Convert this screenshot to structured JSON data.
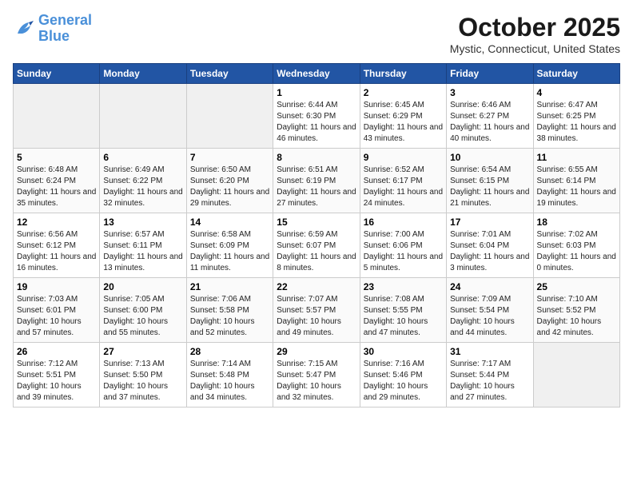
{
  "header": {
    "logo_line1": "General",
    "logo_line2": "Blue",
    "month": "October 2025",
    "location": "Mystic, Connecticut, United States"
  },
  "days_of_week": [
    "Sunday",
    "Monday",
    "Tuesday",
    "Wednesday",
    "Thursday",
    "Friday",
    "Saturday"
  ],
  "weeks": [
    [
      {
        "day": "",
        "empty": true
      },
      {
        "day": "",
        "empty": true
      },
      {
        "day": "",
        "empty": true
      },
      {
        "day": "1",
        "sunrise": "6:44 AM",
        "sunset": "6:30 PM",
        "daylight": "11 hours and 46 minutes."
      },
      {
        "day": "2",
        "sunrise": "6:45 AM",
        "sunset": "6:29 PM",
        "daylight": "11 hours and 43 minutes."
      },
      {
        "day": "3",
        "sunrise": "6:46 AM",
        "sunset": "6:27 PM",
        "daylight": "11 hours and 40 minutes."
      },
      {
        "day": "4",
        "sunrise": "6:47 AM",
        "sunset": "6:25 PM",
        "daylight": "11 hours and 38 minutes."
      }
    ],
    [
      {
        "day": "5",
        "sunrise": "6:48 AM",
        "sunset": "6:24 PM",
        "daylight": "11 hours and 35 minutes."
      },
      {
        "day": "6",
        "sunrise": "6:49 AM",
        "sunset": "6:22 PM",
        "daylight": "11 hours and 32 minutes."
      },
      {
        "day": "7",
        "sunrise": "6:50 AM",
        "sunset": "6:20 PM",
        "daylight": "11 hours and 29 minutes."
      },
      {
        "day": "8",
        "sunrise": "6:51 AM",
        "sunset": "6:19 PM",
        "daylight": "11 hours and 27 minutes."
      },
      {
        "day": "9",
        "sunrise": "6:52 AM",
        "sunset": "6:17 PM",
        "daylight": "11 hours and 24 minutes."
      },
      {
        "day": "10",
        "sunrise": "6:54 AM",
        "sunset": "6:15 PM",
        "daylight": "11 hours and 21 minutes."
      },
      {
        "day": "11",
        "sunrise": "6:55 AM",
        "sunset": "6:14 PM",
        "daylight": "11 hours and 19 minutes."
      }
    ],
    [
      {
        "day": "12",
        "sunrise": "6:56 AM",
        "sunset": "6:12 PM",
        "daylight": "11 hours and 16 minutes."
      },
      {
        "day": "13",
        "sunrise": "6:57 AM",
        "sunset": "6:11 PM",
        "daylight": "11 hours and 13 minutes."
      },
      {
        "day": "14",
        "sunrise": "6:58 AM",
        "sunset": "6:09 PM",
        "daylight": "11 hours and 11 minutes."
      },
      {
        "day": "15",
        "sunrise": "6:59 AM",
        "sunset": "6:07 PM",
        "daylight": "11 hours and 8 minutes."
      },
      {
        "day": "16",
        "sunrise": "7:00 AM",
        "sunset": "6:06 PM",
        "daylight": "11 hours and 5 minutes."
      },
      {
        "day": "17",
        "sunrise": "7:01 AM",
        "sunset": "6:04 PM",
        "daylight": "11 hours and 3 minutes."
      },
      {
        "day": "18",
        "sunrise": "7:02 AM",
        "sunset": "6:03 PM",
        "daylight": "11 hours and 0 minutes."
      }
    ],
    [
      {
        "day": "19",
        "sunrise": "7:03 AM",
        "sunset": "6:01 PM",
        "daylight": "10 hours and 57 minutes."
      },
      {
        "day": "20",
        "sunrise": "7:05 AM",
        "sunset": "6:00 PM",
        "daylight": "10 hours and 55 minutes."
      },
      {
        "day": "21",
        "sunrise": "7:06 AM",
        "sunset": "5:58 PM",
        "daylight": "10 hours and 52 minutes."
      },
      {
        "day": "22",
        "sunrise": "7:07 AM",
        "sunset": "5:57 PM",
        "daylight": "10 hours and 49 minutes."
      },
      {
        "day": "23",
        "sunrise": "7:08 AM",
        "sunset": "5:55 PM",
        "daylight": "10 hours and 47 minutes."
      },
      {
        "day": "24",
        "sunrise": "7:09 AM",
        "sunset": "5:54 PM",
        "daylight": "10 hours and 44 minutes."
      },
      {
        "day": "25",
        "sunrise": "7:10 AM",
        "sunset": "5:52 PM",
        "daylight": "10 hours and 42 minutes."
      }
    ],
    [
      {
        "day": "26",
        "sunrise": "7:12 AM",
        "sunset": "5:51 PM",
        "daylight": "10 hours and 39 minutes."
      },
      {
        "day": "27",
        "sunrise": "7:13 AM",
        "sunset": "5:50 PM",
        "daylight": "10 hours and 37 minutes."
      },
      {
        "day": "28",
        "sunrise": "7:14 AM",
        "sunset": "5:48 PM",
        "daylight": "10 hours and 34 minutes."
      },
      {
        "day": "29",
        "sunrise": "7:15 AM",
        "sunset": "5:47 PM",
        "daylight": "10 hours and 32 minutes."
      },
      {
        "day": "30",
        "sunrise": "7:16 AM",
        "sunset": "5:46 PM",
        "daylight": "10 hours and 29 minutes."
      },
      {
        "day": "31",
        "sunrise": "7:17 AM",
        "sunset": "5:44 PM",
        "daylight": "10 hours and 27 minutes."
      },
      {
        "day": "",
        "empty": true
      }
    ]
  ]
}
